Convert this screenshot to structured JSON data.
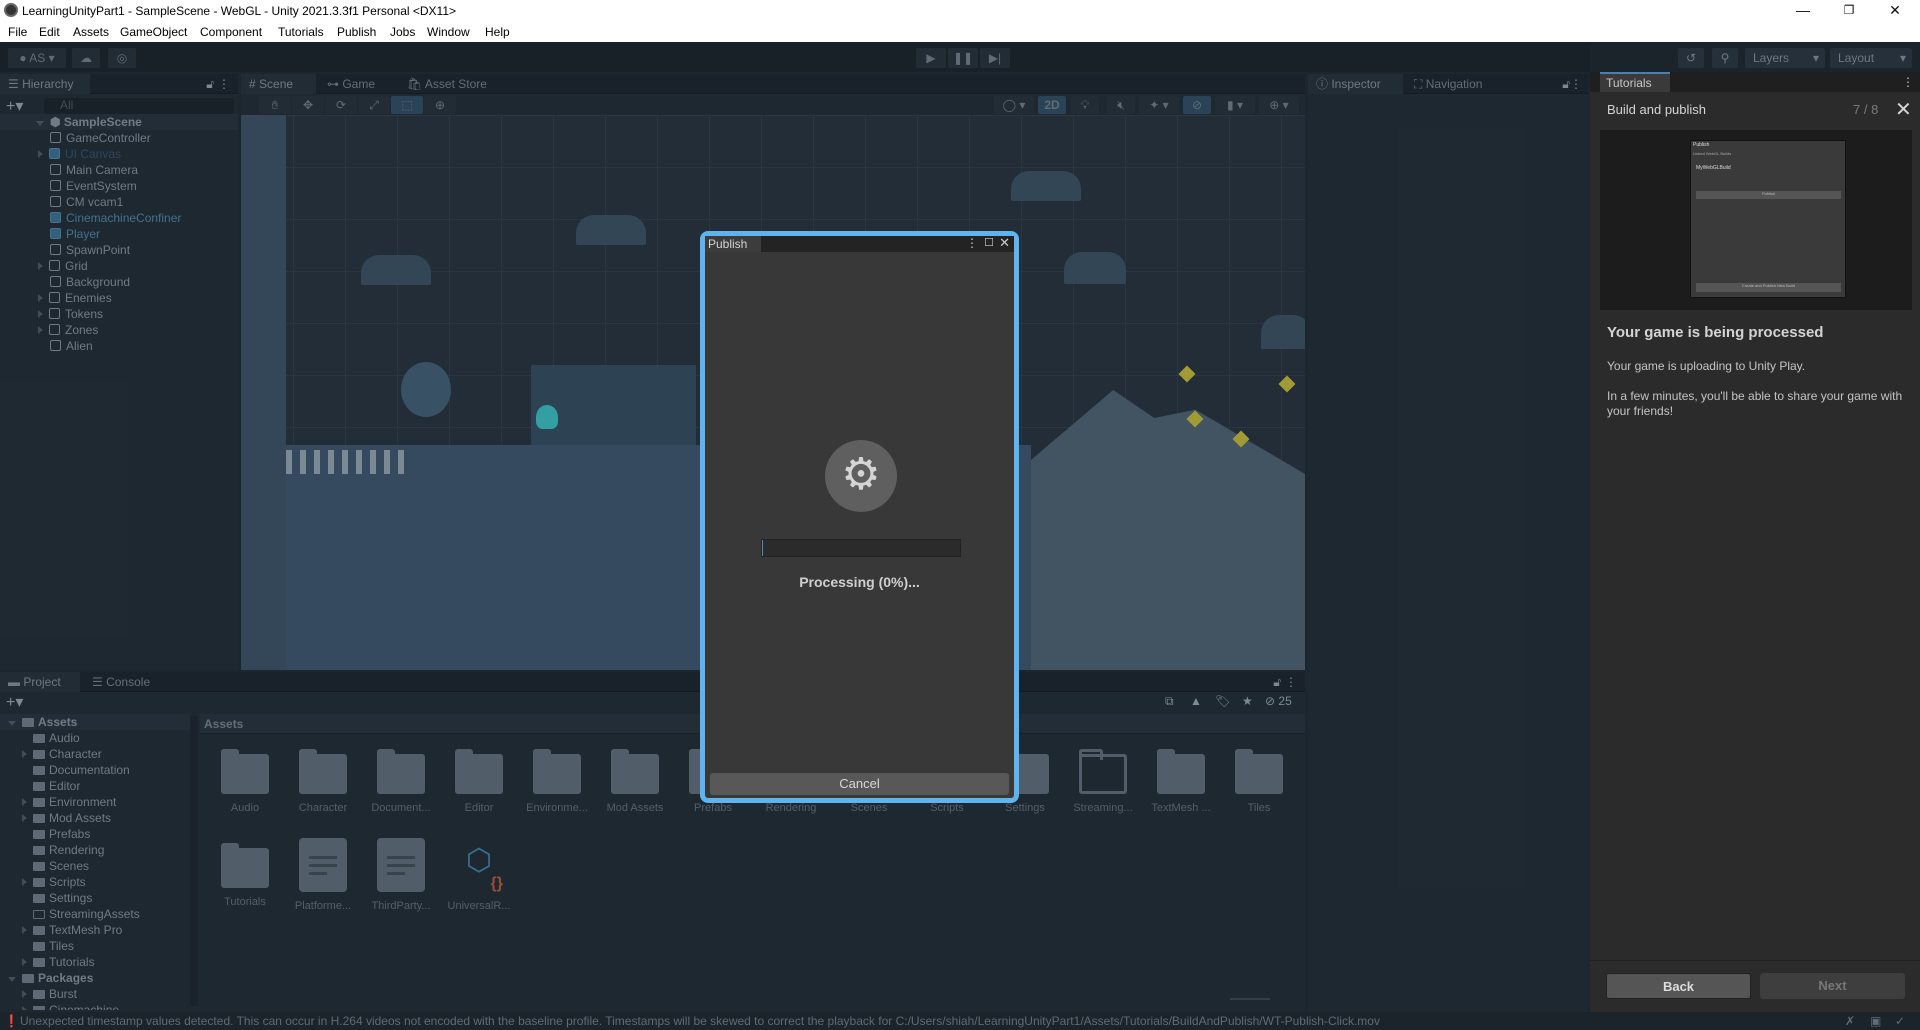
{
  "window": {
    "title": "LearningUnityPart1 - SampleScene - WebGL - Unity 2021.3.3f1 Personal <DX11>",
    "minimize": "—",
    "maximize": "❐",
    "close": "✕"
  },
  "menu": [
    "File",
    "Edit",
    "Assets",
    "GameObject",
    "Component",
    "Tutorials",
    "Publish",
    "Jobs",
    "Window",
    "Help"
  ],
  "toolbar": {
    "account": "AS",
    "layers": "Layers",
    "layout": "Layout"
  },
  "hierarchy": {
    "tab": "Hierarchy",
    "search_placeholder": "All",
    "scene": "SampleScene",
    "items": [
      {
        "label": "GameController",
        "type": "plain",
        "expand": false
      },
      {
        "label": "UI Canvas",
        "type": "prefab-dim",
        "expand": true
      },
      {
        "label": "Main Camera",
        "type": "plain",
        "expand": false
      },
      {
        "label": "EventSystem",
        "type": "plain",
        "expand": false
      },
      {
        "label": "CM vcam1",
        "type": "plain",
        "expand": false
      },
      {
        "label": "CinemachineConfiner",
        "type": "prefab",
        "expand": false
      },
      {
        "label": "Player",
        "type": "prefab",
        "expand": false
      },
      {
        "label": "SpawnPoint",
        "type": "plain",
        "expand": false
      },
      {
        "label": "Grid",
        "type": "plain",
        "expand": true
      },
      {
        "label": "Background",
        "type": "plain",
        "expand": false
      },
      {
        "label": "Enemies",
        "type": "plain",
        "expand": true
      },
      {
        "label": "Tokens",
        "type": "plain",
        "expand": true
      },
      {
        "label": "Zones",
        "type": "plain",
        "expand": true
      },
      {
        "label": "Alien",
        "type": "plain",
        "expand": false
      }
    ]
  },
  "scene_tabs": [
    "Scene",
    "Game",
    "Asset Store"
  ],
  "scene_toolbar": {
    "mode_2d": "2D"
  },
  "inspector_tabs": [
    "Inspector",
    "Navigation"
  ],
  "publish_dialog": {
    "tab": "Publish",
    "status": "Processing (0%)...",
    "progress": 0,
    "cancel": "Cancel"
  },
  "project": {
    "tabs": [
      "Project",
      "Console"
    ],
    "tree": [
      {
        "label": "Assets",
        "level": 0,
        "open": true
      },
      {
        "label": "Audio",
        "level": 1,
        "expand": false
      },
      {
        "label": "Character",
        "level": 1,
        "expand": true
      },
      {
        "label": "Documentation",
        "level": 1,
        "expand": false
      },
      {
        "label": "Editor",
        "level": 1,
        "expand": false
      },
      {
        "label": "Environment",
        "level": 1,
        "expand": true
      },
      {
        "label": "Mod Assets",
        "level": 1,
        "expand": true
      },
      {
        "label": "Prefabs",
        "level": 1,
        "expand": false
      },
      {
        "label": "Rendering",
        "level": 1,
        "expand": false
      },
      {
        "label": "Scenes",
        "level": 1,
        "expand": false
      },
      {
        "label": "Scripts",
        "level": 1,
        "expand": true
      },
      {
        "label": "Settings",
        "level": 1,
        "expand": false
      },
      {
        "label": "StreamingAssets",
        "level": 1,
        "expand": false,
        "empty": true
      },
      {
        "label": "TextMesh Pro",
        "level": 1,
        "expand": true
      },
      {
        "label": "Tiles",
        "level": 1,
        "expand": false
      },
      {
        "label": "Tutorials",
        "level": 1,
        "expand": true
      },
      {
        "label": "Packages",
        "level": 0,
        "open": true
      },
      {
        "label": "Burst",
        "level": 1,
        "expand": true
      },
      {
        "label": "Cinemachine",
        "level": 1,
        "expand": true
      }
    ],
    "breadcrumb": "Assets",
    "hidden_count": "25",
    "assets": [
      {
        "label": "Audio",
        "kind": "folder"
      },
      {
        "label": "Character",
        "kind": "folder"
      },
      {
        "label": "Document...",
        "kind": "folder"
      },
      {
        "label": "Editor",
        "kind": "folder"
      },
      {
        "label": "Environme...",
        "kind": "folder"
      },
      {
        "label": "Mod Assets",
        "kind": "folder"
      },
      {
        "label": "Prefabs",
        "kind": "folder"
      },
      {
        "label": "Rendering",
        "kind": "folder"
      },
      {
        "label": "Scenes",
        "kind": "folder"
      },
      {
        "label": "Scripts",
        "kind": "folder"
      },
      {
        "label": "Settings",
        "kind": "folder"
      },
      {
        "label": "Streaming...",
        "kind": "folder-empty"
      },
      {
        "label": "TextMesh ...",
        "kind": "folder"
      },
      {
        "label": "Tiles",
        "kind": "folder"
      },
      {
        "label": "Tutorials",
        "kind": "folder"
      },
      {
        "label": "Platforme...",
        "kind": "doc"
      },
      {
        "label": "ThirdParty...",
        "kind": "doc"
      },
      {
        "label": "UniversalR...",
        "kind": "asmdef"
      }
    ]
  },
  "tutorials": {
    "tab": "Tutorials",
    "section": "Build and publish",
    "page": "7 / 8",
    "preview": {
      "tab": "Publish",
      "build_list": "Linked WebGL Builds",
      "build_name": "MyWebGLBuild",
      "publish": "Publish",
      "create": "Create and Publish New Build"
    },
    "heading": "Your game is being processed",
    "para1": "Your game is uploading to Unity Play.",
    "para2": "In a few minutes, you'll be able to share your game with your friends!",
    "back": "Back",
    "next": "Next"
  },
  "status": {
    "message": "Unexpected timestamp values detected. This can occur in H.264 videos not encoded with the baseline profile. Timestamps will be skewed to correct the playback for C:/Users/shiah/LearningUnityPart1/Assets/Tutorials/BuildAndPublish/WT-Publish-Click.mov"
  },
  "colors": {
    "accent": "#5fb3ee",
    "prefab": "#4d7fa0"
  }
}
